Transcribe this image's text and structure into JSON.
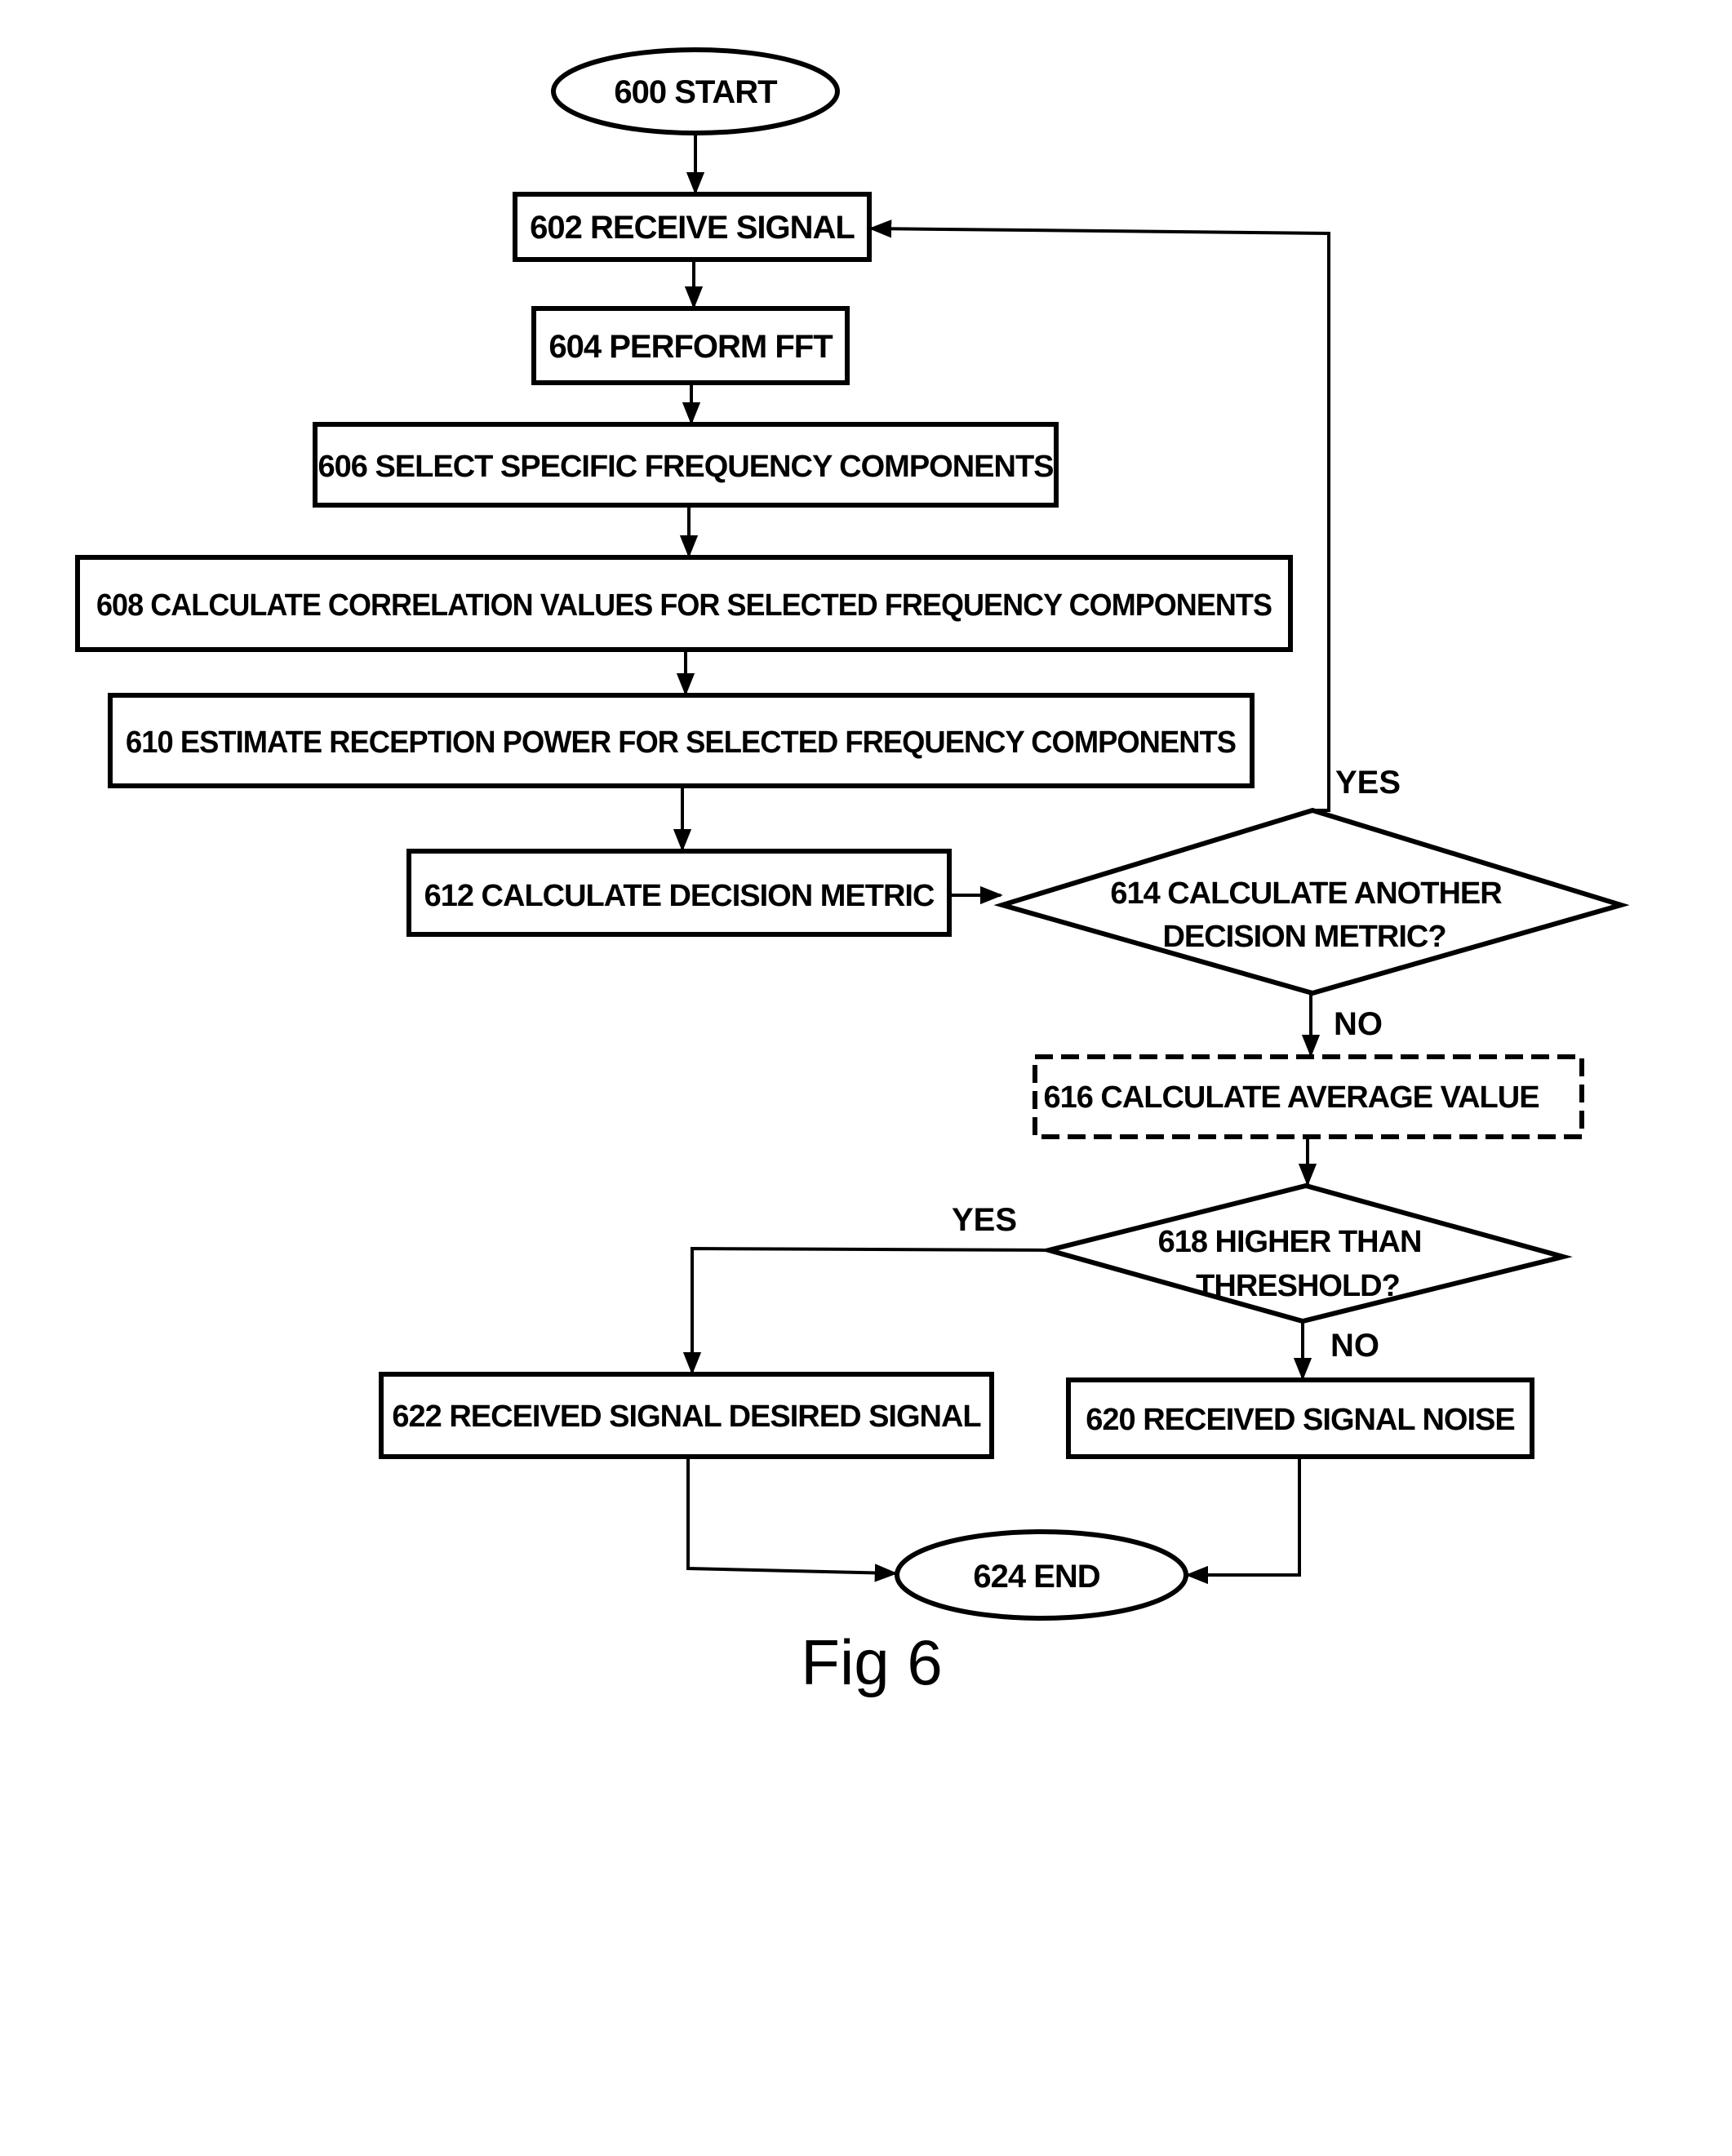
{
  "figure": {
    "caption": "Fig 6",
    "nodes": {
      "n600": "600 START",
      "n602": "602 RECEIVE SIGNAL",
      "n604": "604 PERFORM FFT",
      "n606": "606 SELECT SPECIFIC FREQUENCY COMPONENTS",
      "n608": "608 CALCULATE CORRELATION VALUES FOR SELECTED FREQUENCY COMPONENTS",
      "n610": "610 ESTIMATE RECEPTION POWER FOR SELECTED FREQUENCY COMPONENTS",
      "n612": "612 CALCULATE DECISION METRIC",
      "n614_line1": "614 CALCULATE ANOTHER",
      "n614_line2": "DECISION METRIC?",
      "n616": "616 CALCULATE AVERAGE VALUE",
      "n618_line1": "618 HIGHER THAN",
      "n618_line2": "THRESHOLD?",
      "n620": "620 RECEIVED SIGNAL NOISE",
      "n622": "622 RECEIVED SIGNAL DESIRED SIGNAL",
      "n624": "624 END"
    },
    "edge_labels": {
      "yes_614": "YES",
      "no_614": "NO",
      "yes_618": "YES",
      "no_618": "NO"
    }
  }
}
